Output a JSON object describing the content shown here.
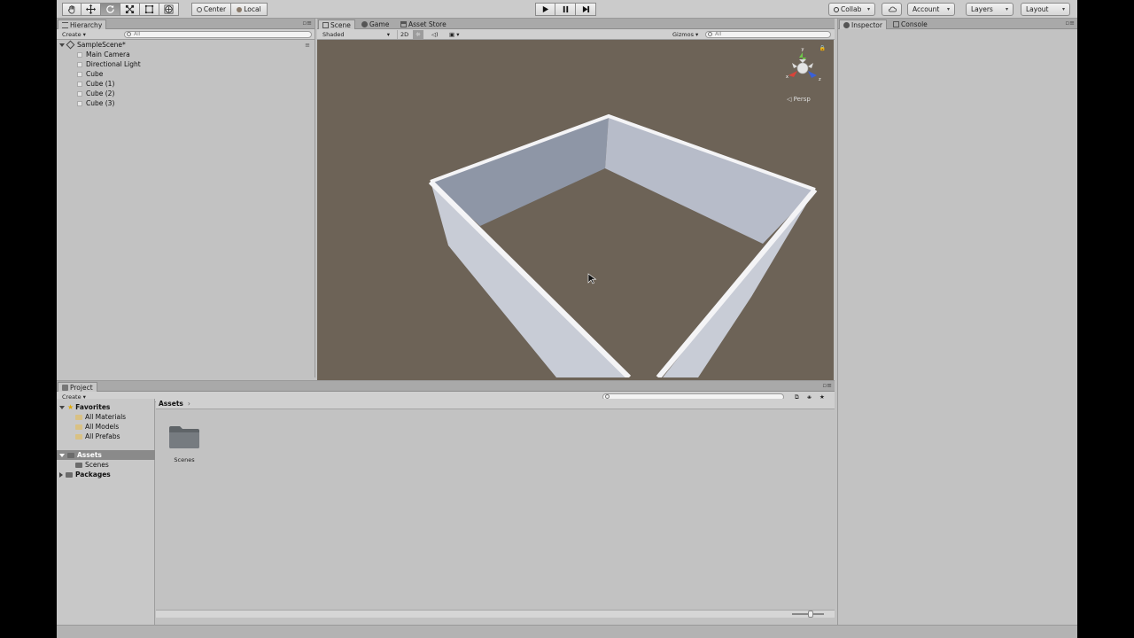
{
  "toolbar": {
    "tools": [
      "hand-tool",
      "move-tool",
      "rotate-tool",
      "scale-tool",
      "rect-tool",
      "transform-tool"
    ],
    "pivot_mode": "Center",
    "pivot_rotation": "Local",
    "collab_label": "Collab",
    "account_label": "Account",
    "layers_label": "Layers",
    "layout_label": "Layout"
  },
  "hierarchy": {
    "tab_label": "Hierarchy",
    "create_label": "Create",
    "search_placeholder": "All",
    "scene_name": "SampleScene*",
    "items": [
      {
        "label": "Main Camera"
      },
      {
        "label": "Directional Light"
      },
      {
        "label": "Cube"
      },
      {
        "label": "Cube (1)"
      },
      {
        "label": "Cube (2)"
      },
      {
        "label": "Cube (3)"
      }
    ]
  },
  "scene": {
    "tabs": [
      "Scene",
      "Game",
      "Asset Store"
    ],
    "shading_mode": "Shaded",
    "mode_2d": "2D",
    "gizmos_label": "Gizmos",
    "search_placeholder": "All",
    "projection_label": "Persp",
    "background_color": "#6d6357"
  },
  "project": {
    "tab_label": "Project",
    "create_label": "Create",
    "favorites_label": "Favorites",
    "favorites": [
      "All Materials",
      "All Models",
      "All Prefabs"
    ],
    "assets_label": "Assets",
    "asset_folders": [
      "Scenes"
    ],
    "packages_label": "Packages",
    "breadcrumb": "Assets",
    "items": [
      {
        "label": "Scenes"
      }
    ]
  },
  "inspector": {
    "tabs": [
      "Inspector",
      "Console"
    ]
  }
}
